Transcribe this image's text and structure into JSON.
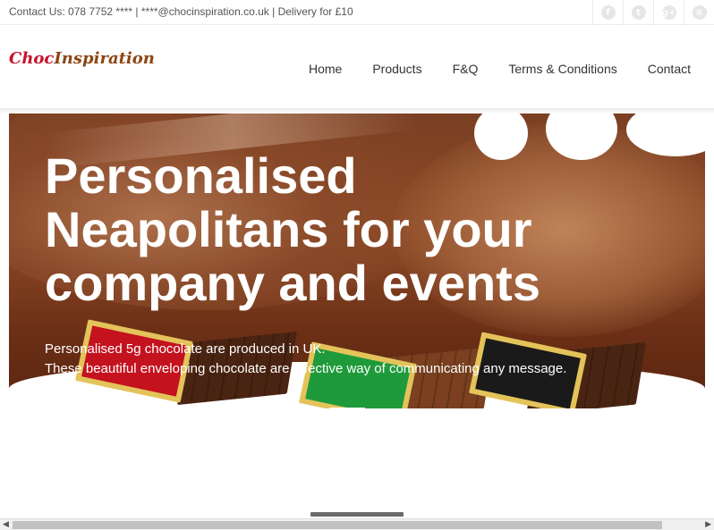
{
  "topbar": {
    "contact_text": "Contact Us: 078 7752 **** | ****@chocinspiration.co.uk | Delivery for £10",
    "socials": [
      {
        "icon": "facebook-icon",
        "glyph": "f"
      },
      {
        "icon": "twitter-icon",
        "glyph": "t"
      },
      {
        "icon": "google-plus-icon",
        "glyph": "g+"
      },
      {
        "icon": "rss-icon",
        "glyph": "≡"
      }
    ]
  },
  "logo": {
    "part1": "Choc",
    "part2": "Inspiration"
  },
  "nav": {
    "items": [
      {
        "label": "Home"
      },
      {
        "label": "Products"
      },
      {
        "label": "F&Q"
      },
      {
        "label": "Terms & Conditions"
      },
      {
        "label": "Contact"
      }
    ]
  },
  "hero": {
    "title": "Personalised Neapolitans for your company and events",
    "line1": "Personalised 5g chocolate are produced in UK.",
    "line2": "These beautiful enveloping chocolate are effective way of communicating any message."
  },
  "colors": {
    "brand_red": "#c8102e",
    "brand_brown": "#8b4513",
    "wrapper_red": "#c4121f",
    "wrapper_green": "#1f9a3a",
    "wrapper_black": "#1a1a1a",
    "foil_gold": "#e3c35a"
  }
}
